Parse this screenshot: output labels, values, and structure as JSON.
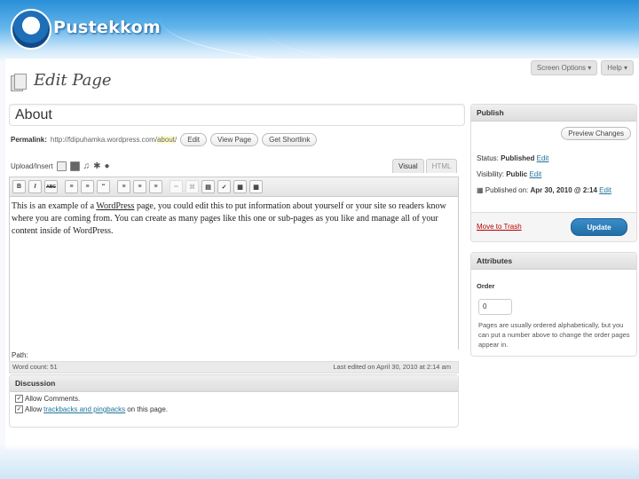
{
  "brand": {
    "name": "Pustekkom"
  },
  "screen_options": {
    "label": "Screen Options ▾"
  },
  "help": {
    "label": "Help ▾"
  },
  "page_heading": "Edit Page",
  "post_title": "About",
  "permalink": {
    "label": "Permalink:",
    "base": "http://fdipuhamka.wordpress.com/",
    "slug": "about",
    "trailing": "/",
    "edit": "Edit",
    "view": "View Page",
    "shortlink": "Get Shortlink"
  },
  "upload": {
    "label": "Upload/Insert"
  },
  "editor_tabs": [
    "Visual",
    "HTML"
  ],
  "toolbar": [
    "B",
    "I",
    "ABC",
    "≡",
    "≡",
    "“",
    "≡",
    "≡",
    "≡",
    "∞",
    "⌘",
    "▤",
    "✓",
    "▦",
    "▦"
  ],
  "content": {
    "before": "This is an example of a ",
    "underlined": "WordPress",
    "after": " page, you could edit this to put information about yourself or your site so readers know where you are coming from. You can create as many pages like this one or sub-pages as you like and manage all of your content inside of WordPress."
  },
  "editor_path": "Path:",
  "word_count": "Word count: 51",
  "last_edited": "Last edited on April 30, 2010 at 2:14 am",
  "discussion": {
    "title": "Discussion",
    "allow_comments": "Allow Comments.",
    "allow_tb_prefix": "Allow ",
    "allow_tb_link": "trackbacks and pingbacks",
    "allow_tb_suffix": " on this page."
  },
  "publish": {
    "title": "Publish",
    "preview": "Preview Changes",
    "status_label": "Status:",
    "status_value": "Published",
    "visibility_label": "Visibility:",
    "visibility_value": "Public",
    "published_label": "Published on:",
    "published_value": "Apr 30, 2010 @ 2:14",
    "edit": "Edit",
    "trash": "Move to Trash",
    "update": "Update"
  },
  "attributes": {
    "title": "Attributes",
    "order_label": "Order",
    "order_value": "0",
    "help": "Pages are usually ordered alphabetically, but you can put a number above to change the order pages appear in."
  },
  "colors": {
    "accent": "#21759b",
    "update": "#2a7bb8",
    "trash": "#bb0000"
  }
}
